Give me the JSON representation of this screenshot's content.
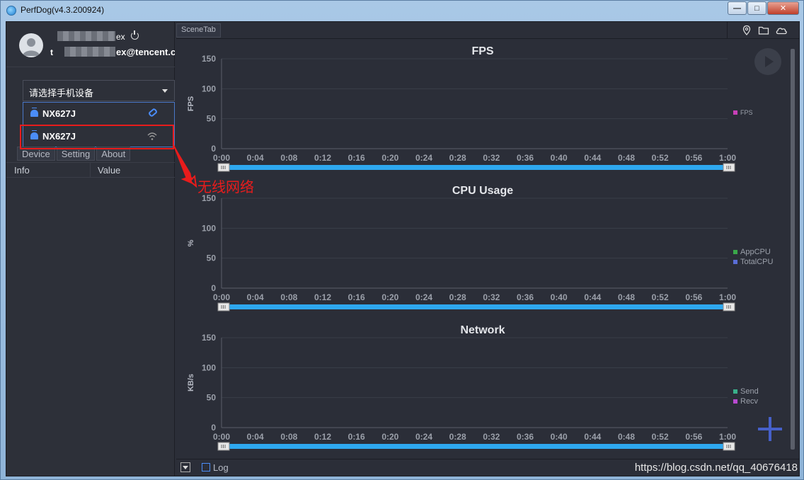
{
  "window": {
    "title": "PerfDog(v4.3.200924)",
    "minimize": "—",
    "maximize": "□",
    "close": "✕"
  },
  "user": {
    "name_suffix": "ex",
    "email_prefix": "t",
    "email_suffix": "ex@tencent.c"
  },
  "device_select": {
    "placeholder": "请选择手机设备"
  },
  "devices": [
    {
      "name": "NX627J",
      "connection": "usb"
    },
    {
      "name": "NX627J",
      "connection": "wifi"
    }
  ],
  "tabs": [
    "Device",
    "Setting",
    "About"
  ],
  "info_table": {
    "headers": [
      "Info",
      "Value"
    ]
  },
  "annotation": {
    "text": "无线网络",
    "color": "#e81c1c"
  },
  "scene_tab": "SceneTab",
  "bottom": {
    "log_label": "Log",
    "watermark": "https://blog.csdn.net/qq_40676418"
  },
  "colors": {
    "bg": "#2b2e38",
    "slider": "#2ea8ef",
    "accent": "#4b8df8"
  },
  "chart_data": [
    {
      "type": "line",
      "title": "FPS",
      "ylabel": "FPS",
      "ylim": [
        0,
        150
      ],
      "yticks": [
        0,
        50,
        100,
        150
      ],
      "x": [
        "0:00",
        "0:04",
        "0:08",
        "0:12",
        "0:16",
        "0:20",
        "0:24",
        "0:28",
        "0:32",
        "0:36",
        "0:40",
        "0:44",
        "0:48",
        "0:52",
        "0:56",
        "1:00"
      ],
      "series": [
        {
          "name": "FPS",
          "color": "#c840b8",
          "values": []
        }
      ]
    },
    {
      "type": "line",
      "title": "CPU Usage",
      "ylabel": "%",
      "ylim": [
        0,
        150
      ],
      "yticks": [
        0,
        50,
        100,
        150
      ],
      "x": [
        "0:00",
        "0:04",
        "0:08",
        "0:12",
        "0:16",
        "0:20",
        "0:24",
        "0:28",
        "0:32",
        "0:36",
        "0:40",
        "0:44",
        "0:48",
        "0:52",
        "0:56",
        "1:00"
      ],
      "series": [
        {
          "name": "AppCPU",
          "color": "#3aa84a",
          "values": []
        },
        {
          "name": "TotalCPU",
          "color": "#5a6ed6",
          "values": []
        }
      ]
    },
    {
      "type": "line",
      "title": "Network",
      "ylabel": "KB/s",
      "ylim": [
        0,
        150
      ],
      "yticks": [
        0,
        50,
        100,
        150
      ],
      "x": [
        "0:00",
        "0:04",
        "0:08",
        "0:12",
        "0:16",
        "0:20",
        "0:24",
        "0:28",
        "0:32",
        "0:36",
        "0:40",
        "0:44",
        "0:48",
        "0:52",
        "0:56",
        "1:00"
      ],
      "series": [
        {
          "name": "Send",
          "color": "#3ab08a",
          "values": []
        },
        {
          "name": "Recv",
          "color": "#b84ad0",
          "values": []
        }
      ]
    }
  ]
}
